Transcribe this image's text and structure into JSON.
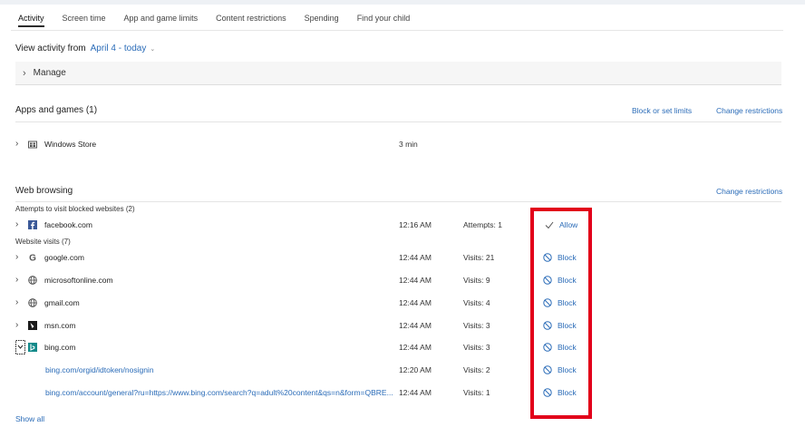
{
  "tabs": [
    "Activity",
    "Screen time",
    "App and game limits",
    "Content restrictions",
    "Spending",
    "Find your child"
  ],
  "view_activity": {
    "label": "View activity from",
    "range": "April 4 - today"
  },
  "manage": {
    "label": "Manage"
  },
  "apps": {
    "title": "Apps and games (1)",
    "block_link": "Block or set limits",
    "change_link": "Change restrictions",
    "items": [
      {
        "name": "Windows Store",
        "time": "3 min"
      }
    ]
  },
  "web": {
    "title": "Web browsing",
    "change_link": "Change restrictions",
    "blocked_heading": "Attempts to visit blocked websites (2)",
    "blocked": [
      {
        "name": "facebook.com",
        "time": "12:16 AM",
        "count": "Attempts: 1",
        "action": "Allow"
      }
    ],
    "visits_heading": "Website visits (7)",
    "visits": [
      {
        "name": "google.com",
        "time": "12:44 AM",
        "count": "Visits: 21",
        "action": "Block"
      },
      {
        "name": "microsoftonline.com",
        "time": "12:44 AM",
        "count": "Visits: 9",
        "action": "Block"
      },
      {
        "name": "gmail.com",
        "time": "12:44 AM",
        "count": "Visits: 4",
        "action": "Block"
      },
      {
        "name": "msn.com",
        "time": "12:44 AM",
        "count": "Visits: 3",
        "action": "Block"
      },
      {
        "name": "bing.com",
        "time": "12:44 AM",
        "count": "Visits: 3",
        "action": "Block"
      }
    ],
    "subvisits": [
      {
        "name": "bing.com/orgid/idtoken/nosignin",
        "time": "12:20 AM",
        "count": "Visits: 2",
        "action": "Block"
      },
      {
        "name": "bing.com/account/general?ru=https://www.bing.com/search?q=adult%20content&qs=n&form=QBRE...",
        "time": "12:44 AM",
        "count": "Visits: 1",
        "action": "Block"
      }
    ],
    "show_all": "Show all"
  },
  "colors": {
    "link": "#2b6cb8",
    "highlight_box": "#e2001a",
    "facebook": "#3b5998",
    "bing": "#138a8a"
  },
  "icons": {
    "windows_store": "store-icon",
    "facebook": "facebook-icon",
    "google": "google-icon",
    "globe": "globe-icon",
    "msn": "msn-icon",
    "bing": "bing-icon",
    "allow": "check-icon",
    "block": "block-icon"
  }
}
